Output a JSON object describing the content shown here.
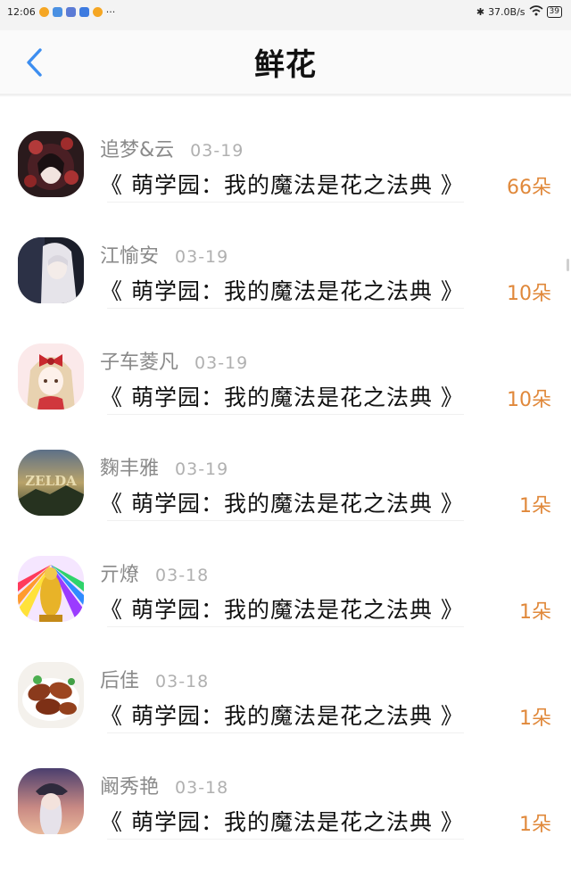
{
  "status_bar": {
    "time": "12:06",
    "network_speed": "37.0B/s",
    "battery": "39"
  },
  "header": {
    "title": "鲜花"
  },
  "list": {
    "items": [
      {
        "username": "追梦&云",
        "date": "03-19",
        "book": "《 萌学园：我的魔法是花之法典 》",
        "count": "66朵",
        "avatar": "avatar-dark-red-anime"
      },
      {
        "username": "江愉安",
        "date": "03-19",
        "book": "《 萌学园：我的魔法是花之法典 》",
        "count": "10朵",
        "avatar": "avatar-white-hair-anime"
      },
      {
        "username": "子车菱凡",
        "date": "03-19",
        "book": "《 萌学园：我的魔法是花之法典 》",
        "count": "10朵",
        "avatar": "avatar-red-bow-anime"
      },
      {
        "username": "麴丰雅",
        "date": "03-19",
        "book": "《 萌学园：我的魔法是花之法典 》",
        "count": "1朵",
        "avatar": "avatar-zelda-logo"
      },
      {
        "username": "亓燎",
        "date": "03-18",
        "book": "《 萌学园：我的魔法是花之法典 》",
        "count": "1朵",
        "avatar": "avatar-golden-buddha"
      },
      {
        "username": "后佳",
        "date": "03-18",
        "book": "《 萌学园：我的魔法是花之法典 》",
        "count": "1朵",
        "avatar": "avatar-chicken-wings"
      },
      {
        "username": "阚秀艳",
        "date": "03-18",
        "book": "《 萌学园：我的魔法是花之法典 》",
        "count": "1朵",
        "avatar": "avatar-sunset-anime"
      }
    ]
  },
  "colors": {
    "accent_blue": "#3d8ef0",
    "count_orange": "#e0883a"
  }
}
